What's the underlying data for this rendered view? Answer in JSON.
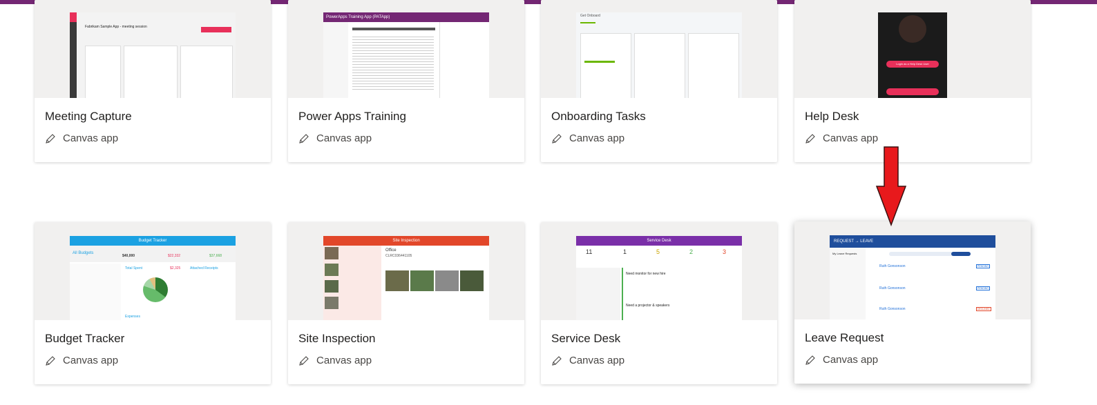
{
  "cards": [
    {
      "title": "Meeting Capture",
      "type": "Canvas app",
      "thumb_label": "Fabrikam Sample App - meeting session"
    },
    {
      "title": "Power Apps Training",
      "type": "Canvas app",
      "thumb_label": "PowerApps Training App (PATApp)"
    },
    {
      "title": "Onboarding Tasks",
      "type": "Canvas app",
      "thumb_label": "Get Onboard"
    },
    {
      "title": "Help Desk",
      "type": "Canvas app",
      "thumb_label": "Login as a Help Desk User"
    },
    {
      "title": "Budget Tracker",
      "type": "Canvas app",
      "thumb_label": "Budget Tracker"
    },
    {
      "title": "Site Inspection",
      "type": "Canvas app",
      "thumb_label": "Site Inspection"
    },
    {
      "title": "Service Desk",
      "type": "Canvas app",
      "thumb_label": "Service Desk"
    },
    {
      "title": "Leave Request",
      "type": "Canvas app",
      "thumb_label": "REQUEST → LEAVE"
    }
  ],
  "thumbs": {
    "budget": {
      "all_budgets": "All Budgets",
      "budget": "$40,000",
      "spent": "$22,332",
      "remaining": "$37,668",
      "total_spent": "Total Spent",
      "total_value": "$2,325",
      "receipts": "Attached Receipts",
      "expenses": "Expenses"
    },
    "site": {
      "office": "Office",
      "code": "CLRC036441105"
    },
    "service": {
      "counts": [
        "11",
        "1",
        "5",
        "2",
        "3"
      ],
      "need_monitor": "Need monitor for new hire",
      "need_projector": "Need a projector & speakers"
    },
    "leave": {
      "tab": "My Leave Requests",
      "name": "Ruth Gonsonson",
      "status_pending": "PENDING",
      "status_declined": "DECLINED"
    }
  },
  "colors": {
    "brand": "#742774",
    "arrow": "#e8191c"
  }
}
